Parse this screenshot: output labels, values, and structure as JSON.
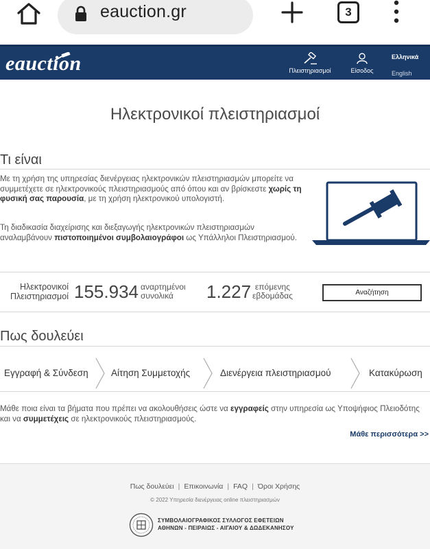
{
  "browser": {
    "url": "eauction.gr",
    "tab_count": "3",
    "home_icon": "home-icon",
    "lock_icon": "lock-icon",
    "new_tab_icon": "plus-icon",
    "menu_icon": "more-vert-icon"
  },
  "header": {
    "logo_prefix": "e",
    "logo_rest": "auction",
    "nav": {
      "auctions_label": "Πλειστηριασμοί",
      "login_label": "Είσοδος"
    },
    "lang_greek": "Ελληνικά",
    "lang_english": "English",
    "colors": {
      "bar": "#1a3a68"
    }
  },
  "page": {
    "title": "Ηλεκτρονικοί πλειστηριασμοί"
  },
  "what_is": {
    "heading": "Τι είναι",
    "para1_a": "Με τη χρήση της υπηρεσίας διενέργειας ηλεκτρονικών πλειστηριασμών μπορείτε να συμμετέχετε σε ηλεκτρονικούς πλειστηριασμούς από όπου και αν βρίσκεστε ",
    "para1_bold": "χωρίς τη φυσική σας παρουσία",
    "para1_b": ", με τη χρήση ηλεκτρονικού υπολογιστή.",
    "para2_a": "Τη διαδικασία διαχείρισης και διεξαγωγής ηλεκτρονικών πλειστηριασμών αναλαμβάνουν ",
    "para2_bold": "πιστοποιημένοι συμβολαιογράφοι",
    "para2_b": " ως Υπάλληλοι Πλειστηριασμού."
  },
  "stats": {
    "label_line1": "Ηλεκτρονικοί",
    "label_line2": "Πλειστηριασμοί",
    "total": "155.934",
    "total_sub_line1": "αναρτημένοι",
    "total_sub_line2": "συνολικά",
    "upcoming": "1.227",
    "upcoming_sub_line1": "επόμενης",
    "upcoming_sub_line2": "εβδομάδας",
    "search_label": "Αναζήτηση"
  },
  "how": {
    "heading": "Πως δουλεύει",
    "steps": [
      "Εγγραφή & Σύνδεση",
      "Αίτηση Συμμετοχής",
      "Διενέργεια πλειστηριασμού",
      "Κατακύρωση"
    ],
    "para_a": "Μάθε ποια είναι τα βήματα που πρέπει να ακολουθήσεις ώστε να ",
    "para_bold1": "εγγραφείς",
    "para_b": " στην υπηρεσία ως Υποψήφιος Πλειοδότης και να ",
    "para_bold2": "συμμετέχεις",
    "para_c": " σε ηλεκτρονικούς πλειστηριασμούς.",
    "learn_more": "Μάθε περισσότερα >>"
  },
  "footer": {
    "links": [
      "Πως δουλεύει",
      "Επικοινωνία",
      "FAQ",
      "Όροι Χρήσης"
    ],
    "separator": "|",
    "copyright": "© 2022 Υπηρεσία διενέργειας online πλειστηριασμών",
    "assoc_line1": "ΣΥΜΒΟΛΑΙΟΓΡΑΦΙΚΟΣ ΣΥΛΛΟΓΟΣ ΕΦΕΤΕΙΩΝ",
    "assoc_line2": "ΑΘΗΝΩΝ - ΠΕΙΡΑΙΩΣ - ΑΙΓΑΙΟΥ & ΔΩΔΕΚΑΝΗΣΟΥ"
  }
}
